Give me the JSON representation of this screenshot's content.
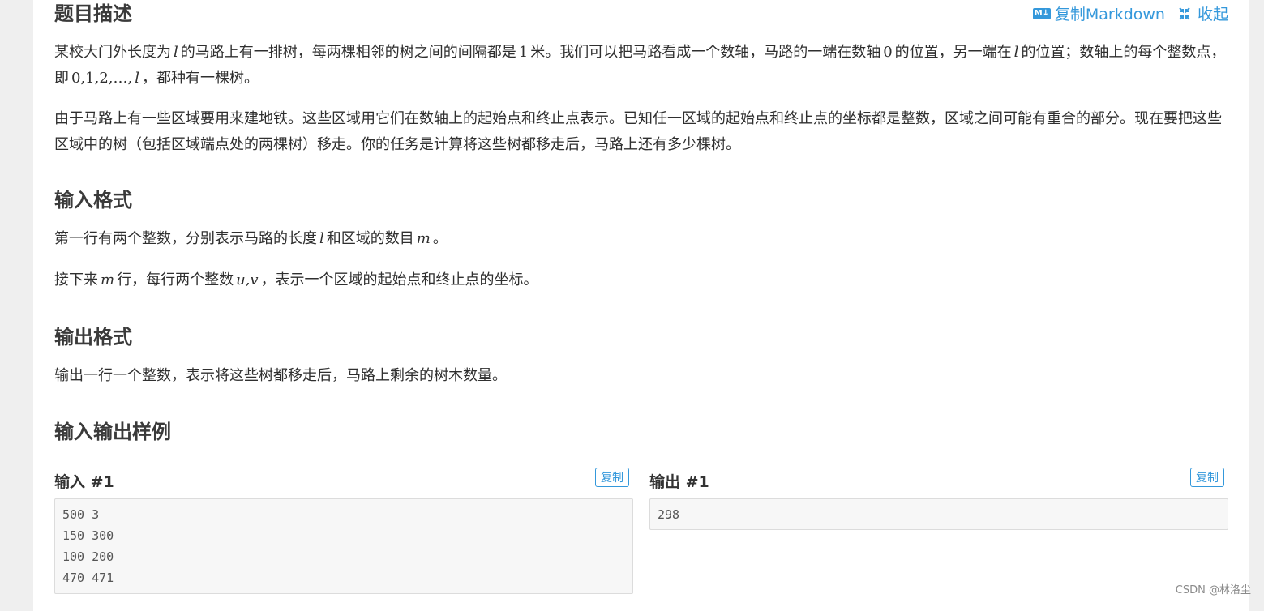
{
  "actions": {
    "copy_markdown_icon": "M↓",
    "copy_markdown": "复制Markdown",
    "collapse": "收起"
  },
  "description": {
    "title": "题目描述",
    "p1": [
      "某校大门外长度为",
      "l",
      "的马路上有一排树，每两棵相邻的树之间的间隔都是",
      "1",
      "米。我们可以把马路看成一个数轴，马路的一端在数轴",
      "0",
      "的位置，另一端在",
      "l",
      "的位置；数轴上的每个整数点，即",
      "0,1,2,…,",
      "l",
      "，都种有一棵树。"
    ],
    "p2": "由于马路上有一些区域要用来建地铁。这些区域用它们在数轴上的起始点和终止点表示。已知任一区域的起始点和终止点的坐标都是整数，区域之间可能有重合的部分。现在要把这些区域中的树（包括区域端点处的两棵树）移走。你的任务是计算将这些树都移走后，马路上还有多少棵树。"
  },
  "input_format": {
    "title": "输入格式",
    "p1": [
      "第一行有两个整数，分别表示马路的长度",
      "l",
      "和区域的数目",
      "m",
      "。"
    ],
    "p2": [
      "接下来",
      "m",
      "行，每行两个整数",
      "u,v",
      "，表示一个区域的起始点和终止点的坐标。"
    ]
  },
  "output_format": {
    "title": "输出格式",
    "p1": "输出一行一个整数，表示将这些树都移走后，马路上剩余的树木数量。"
  },
  "samples": {
    "title": "输入输出样例",
    "input_label": "输入 #1",
    "output_label": "输出 #1",
    "copy_label": "复制",
    "input_text": "500 3\n150 300\n100 200\n470 471",
    "output_text": "298"
  },
  "watermark": "CSDN @林洛尘",
  "colors": {
    "accent": "#3498db",
    "background": "#efefef",
    "card": "#ffffff"
  }
}
